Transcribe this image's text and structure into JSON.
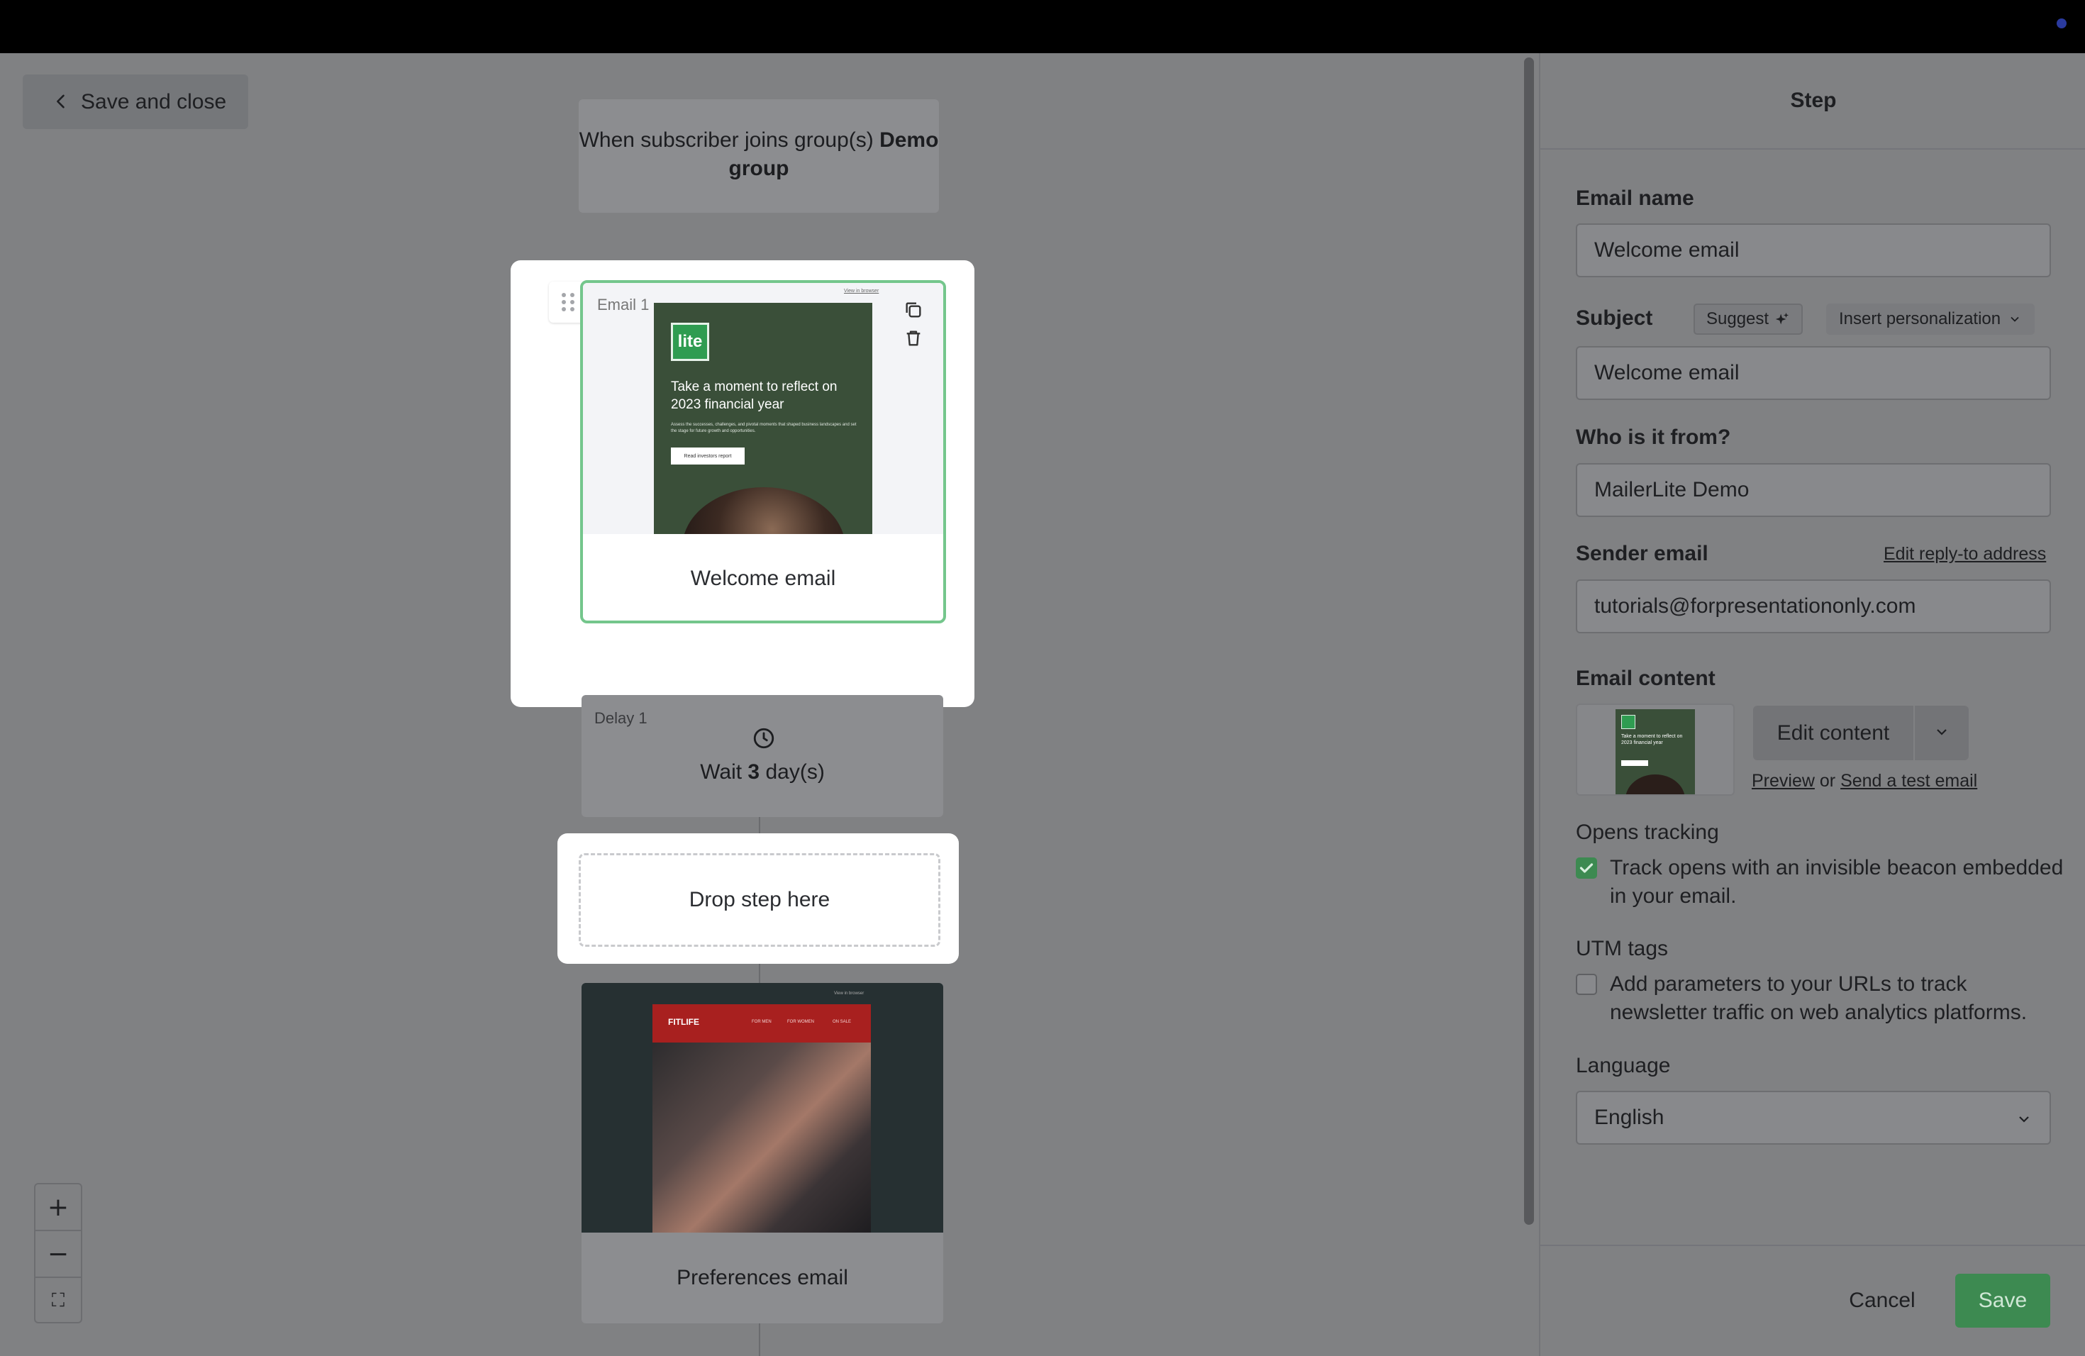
{
  "canvas": {
    "save_close_label": "Save and close",
    "trigger": {
      "prefix": "When subscriber joins group(s)",
      "group": "Demo group"
    },
    "email1": {
      "tag": "Email 1",
      "name": "Welcome email",
      "thumb": {
        "view_link": "View in browser",
        "logo": "lite",
        "headline": "Take a moment to reflect on 2023 financial year",
        "body": "Assess the successes, challenges, and pivotal moments that shaped business landscapes and set the stage for future growth and opportunities.",
        "cta": "Read investors report"
      }
    },
    "delay1": {
      "tag": "Delay 1",
      "prefix": "Wait",
      "amount": "3",
      "unit": "day(s)"
    },
    "drop_zone_label": "Drop step here",
    "preferences_email": {
      "name": "Preferences email",
      "thumb": {
        "view_link": "View in browser",
        "brand": "FITLIFE",
        "nav": [
          "FOR MEN",
          "FOR WOMEN",
          "ON SALE"
        ]
      }
    },
    "zoom": {
      "in": "+",
      "out": "−",
      "fit": "⛶"
    }
  },
  "panel": {
    "title": "Step",
    "email_name": {
      "label": "Email name",
      "value": "Welcome email"
    },
    "subject": {
      "label": "Subject",
      "suggest_label": "Suggest",
      "insert_label": "Insert personalization",
      "value": "Welcome email"
    },
    "from": {
      "label": "Who is it from?",
      "value": "MailerLite Demo"
    },
    "sender": {
      "label": "Sender email",
      "edit_reply_to": "Edit reply-to address",
      "value": "tutorials@forpresentationonly.com"
    },
    "content": {
      "label": "Email content",
      "edit_label": "Edit content",
      "preview": "Preview",
      "or": "or",
      "send_test": "Send a test email"
    },
    "opens_tracking": {
      "label": "Opens tracking",
      "text": "Track opens with an invisible beacon embedded in your email.",
      "checked": true
    },
    "utm": {
      "label": "UTM tags",
      "text": "Add parameters to your URLs to track newsletter traffic on web analytics platforms.",
      "checked": false
    },
    "language": {
      "label": "Language",
      "value": "English"
    },
    "cancel_label": "Cancel",
    "save_label": "Save"
  },
  "colors": {
    "accent": "#3d8a51",
    "selected_border": "#74c68c",
    "overlay": "#808183"
  }
}
